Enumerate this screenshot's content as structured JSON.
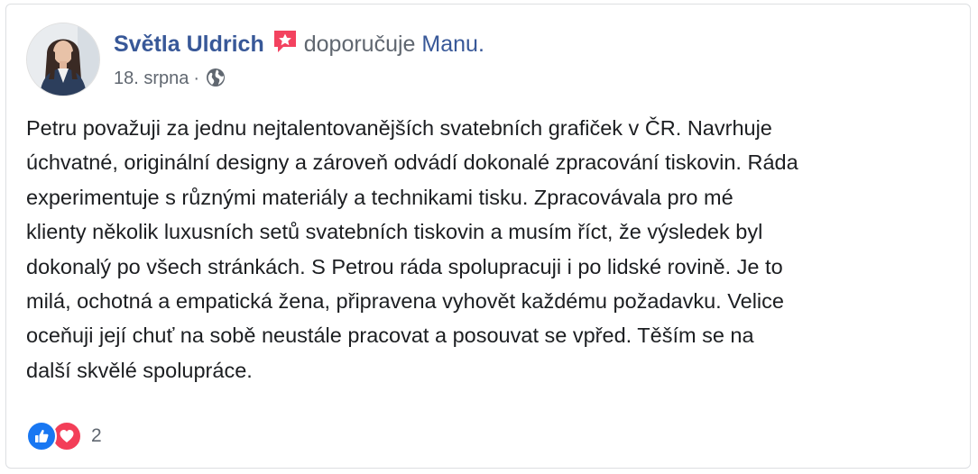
{
  "post": {
    "author": {
      "name": "Světla Uldrich",
      "badge_icon": "recommendation-star-icon",
      "badge_color": "#f3425f"
    },
    "action_text": "doporučuje",
    "page_name": "Manu.",
    "date": "18. srpna",
    "separator": "·",
    "privacy_icon": "globe-icon",
    "body_lines": [
      "Petru považuji za jednu nejtalentovanějších svatebních grafiček v ČR. Navrhuje",
      "úchvatné, originální designy a zároveň odvádí dokonalé zpracování tiskovin. Ráda",
      "experimentuje s různými materiály a technikami tisku. Zpracovávala pro mé",
      "klienty několik luxusních setů svatebních tiskovin a musím říct, že výsledek byl",
      "dokonalý po všech stránkách. S Petrou ráda spolupracuji i po lidské rovině. Je to",
      "milá, ochotná a empatická žena, připravena vyhovět každému požadavku. Velice",
      "oceňuji její chuť na sobě neustále pracovat a posouvat se vpřed. Těším se na",
      "další skvělé spolupráce."
    ],
    "reactions": {
      "icons": [
        "like-icon",
        "love-icon"
      ],
      "count": "2",
      "like_color": "#1877f2",
      "love_color": "#f33e58"
    }
  },
  "colors": {
    "link": "#385898",
    "secondary_text": "#606770",
    "body_text": "#1c1e21"
  }
}
